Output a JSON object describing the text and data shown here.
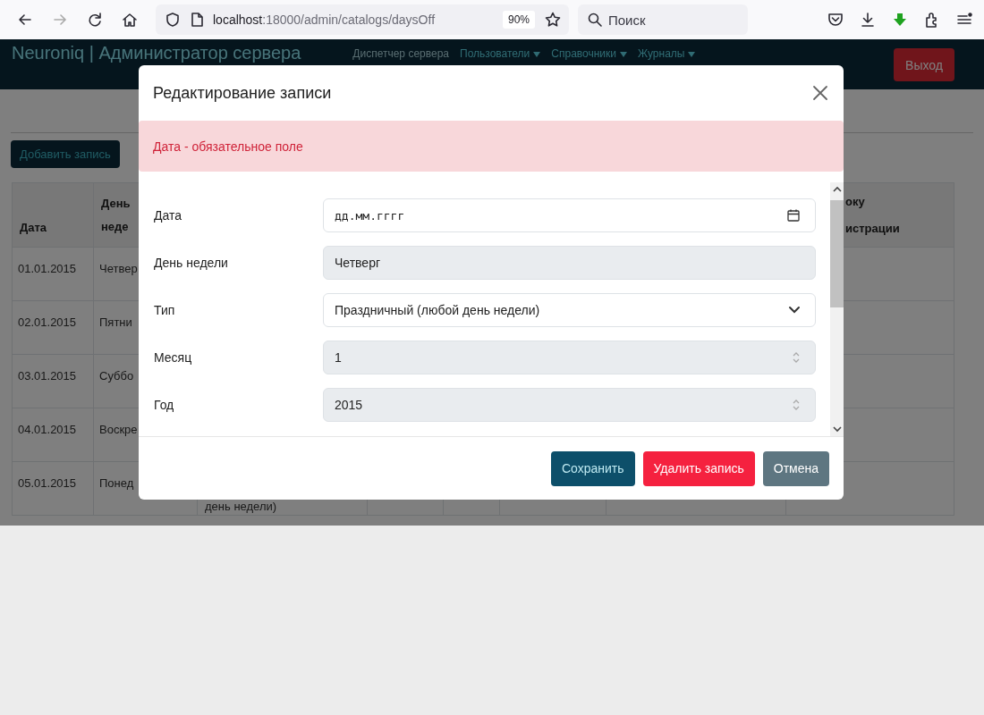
{
  "browser": {
    "url_host": "localhost",
    "url_path": ":18000/admin/catalogs/daysOff",
    "zoom": "90%",
    "search_placeholder": "Поиск"
  },
  "navbar": {
    "brand": "Neuroniq | Администратор сервера",
    "menu": [
      {
        "label": "Диспетчер сервера",
        "dropdown": false
      },
      {
        "label": "Пользователи",
        "dropdown": true
      },
      {
        "label": "Справочники",
        "dropdown": true
      },
      {
        "label": "Журналы",
        "dropdown": true
      }
    ],
    "logout": "Выход"
  },
  "page": {
    "add_button": "Добавить запись",
    "table": {
      "columns": [
        "Дата",
        "День неде",
        "",
        "",
        "",
        "",
        "",
        "оку истрации"
      ],
      "rows": [
        {
          "date": "01.01.2015",
          "weekday": "Четвер"
        },
        {
          "date": "02.01.2015",
          "weekday": "Пятни"
        },
        {
          "date": "03.01.2015",
          "weekday": "Суббо"
        },
        {
          "date": "04.01.2015",
          "weekday": "Воскре"
        },
        {
          "date": "05.01.2015",
          "weekday": "Понед",
          "column_3": "день недели)"
        }
      ]
    }
  },
  "modal": {
    "title": "Редактирование записи",
    "alert": "Дата - обязательное поле",
    "fields": [
      {
        "label": "Дата",
        "kind": "date",
        "placeholder": "дд.мм.гггг",
        "disabled": false
      },
      {
        "label": "День недели",
        "kind": "text",
        "value": "Четверг",
        "disabled": true
      },
      {
        "label": "Тип",
        "kind": "select",
        "value": "Праздничный (любой день недели)",
        "disabled": false
      },
      {
        "label": "Месяц",
        "kind": "number",
        "value": "1",
        "disabled": true
      },
      {
        "label": "Год",
        "kind": "number",
        "value": "2015",
        "disabled": true
      }
    ],
    "buttons": [
      {
        "label": "Сохранить",
        "kind": "primary"
      },
      {
        "label": "Удалить запись",
        "kind": "danger"
      },
      {
        "label": "Отмена",
        "kind": "secondary"
      }
    ]
  }
}
